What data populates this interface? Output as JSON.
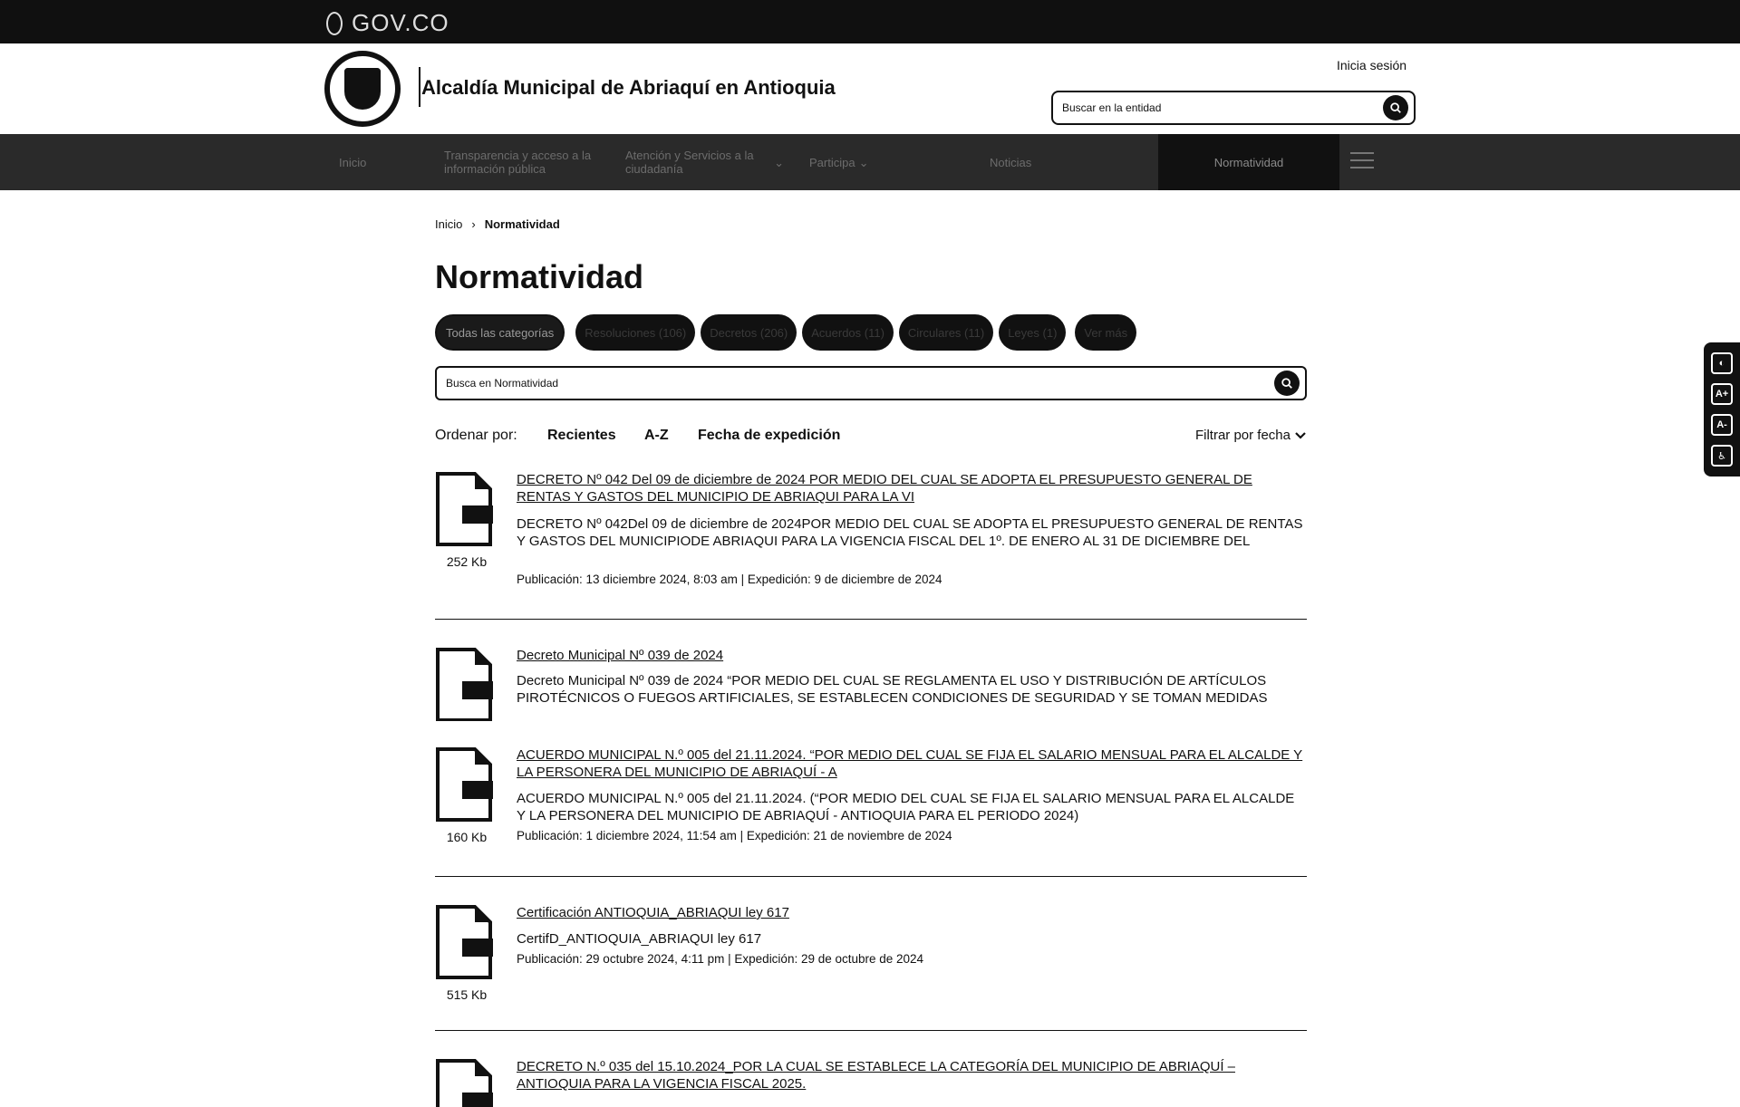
{
  "gov_bar": {
    "logo_text": "GOV.CO"
  },
  "header": {
    "entity_name": "Alcaldía Municipal de Abriaquí en Antioquia",
    "login_label": "Inicia sesión",
    "search_placeholder": "Buscar en la entidad"
  },
  "nav": {
    "items": [
      {
        "label": "Inicio"
      },
      {
        "label": "Transparencia y acceso a la información pública"
      },
      {
        "label": "Atención y Servicios a la ciudadanía"
      },
      {
        "label": "Participa"
      },
      {
        "label": "Noticias"
      },
      {
        "label": "Normatividad"
      }
    ]
  },
  "breadcrumb": {
    "home": "Inicio",
    "current": "Normatividad"
  },
  "page_title": "Normatividad",
  "categories": [
    {
      "label": "Todas las categorías"
    },
    {
      "label": "Resoluciones (106)"
    },
    {
      "label": "Decretos (206)"
    },
    {
      "label": "Acuerdos (11)"
    },
    {
      "label": "Circulares (11)"
    },
    {
      "label": "Leyes (1)"
    },
    {
      "label": "Ver más"
    }
  ],
  "norm_search": {
    "placeholder": "Busca en Normatividad"
  },
  "sort": {
    "label": "Ordenar por:",
    "options": [
      "Recientes",
      "A-Z",
      "Fecha de expedición"
    ],
    "filter_label": "Filtrar por fecha"
  },
  "documents": [
    {
      "title": "DECRETO Nº 042 Del 09 de diciembre de 2024 POR MEDIO DEL CUAL SE ADOPTA EL PRESUPUESTO GENERAL DE RENTAS Y GASTOS DEL MUNICIPIO DE ABRIAQUI PARA LA VI",
      "description": "DECRETO Nº 042Del 09 de diciembre de 2024POR MEDIO DEL CUAL SE ADOPTA EL PRESUPUESTO GENERAL DE RENTAS Y GASTOS DEL MUNICIPIODE ABRIAQUI PARA LA VIGENCIA FISCAL DEL 1º. DE ENERO AL 31 DE DICIEMBRE DEL",
      "meta": "Publicación: 13 diciembre 2024, 8:03 am  |  Expedición: 9 de diciembre de 2024",
      "size": "252 Kb"
    },
    {
      "title": "Decreto Municipal Nº 039 de 2024",
      "description": "Decreto Municipal Nº 039 de 2024  “POR MEDIO DEL CUAL SE REGLAMENTA EL USO Y DISTRIBUCIÓN DE ARTÍCULOS PIROTÉCNICOS O FUEGOS ARTIFICIALES, SE ESTABLECEN CONDICIONES DE SEGURIDAD Y SE TOMAN MEDIDAS",
      "meta": "",
      "size": ""
    },
    {
      "title": "ACUERDO MUNICIPAL N.º 005 del 21.11.2024. “POR MEDIO DEL CUAL SE FIJA EL SALARIO MENSUAL PARA EL ALCALDE Y LA PERSONERA DEL MUNICIPIO DE ABRIAQUÍ - A",
      "description": "ACUERDO MUNICIPAL N.º 005 del 21.11.2024. (“POR MEDIO DEL CUAL SE FIJA EL SALARIO MENSUAL PARA EL ALCALDE Y LA PERSONERA DEL MUNICIPIO DE ABRIAQUÍ - ANTIOQUIA PARA EL PERIODO 2024)",
      "meta": "Publicación: 1 diciembre 2024, 11:54 am  |  Expedición: 21 de noviembre de 2024",
      "size": "160 Kb"
    },
    {
      "title": "Certificación ANTIOQUIA_ABRIAQUI ley 617",
      "description": "CertifD_ANTIOQUIA_ABRIAQUI ley 617",
      "meta": "Publicación: 29 octubre 2024, 4:11 pm  |  Expedición: 29 de octubre de 2024",
      "size": "515 Kb"
    },
    {
      "title": "DECRETO N.º 035 del 15.10.2024_POR LA CUAL SE ESTABLECE LA CATEGORÍA DEL MUNICIPIO DE ABRIAQUÍ – ANTIOQUIA PARA LA VIGENCIA FISCAL 2025.",
      "description": "",
      "meta": "",
      "size": ""
    }
  ],
  "a11y": {
    "contrast": "◐",
    "increase": "A+",
    "decrease": "A-",
    "relevo": "♿"
  }
}
